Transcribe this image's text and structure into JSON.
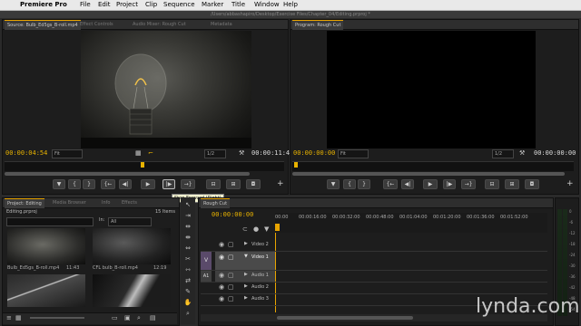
{
  "menubar": {
    "apple": "",
    "app": "Premiere Pro",
    "items": [
      "File",
      "Edit",
      "Project",
      "Clip",
      "Sequence",
      "Marker",
      "Title",
      "Window",
      "Help"
    ]
  },
  "path": "/Users/abbashapiro/Desktop/Exercise Files/Chapter_04/Editing.prproj *",
  "source": {
    "tabs": [
      "Source: Bulb_Ed5gs_B-roll.mp4",
      "Effect Controls",
      "Audio Mixer: Rough Cut",
      "Metadata"
    ],
    "timecode_in": "00:00:04:54",
    "timecode_dur": "00:00:11:43",
    "zoom": "Fit",
    "resolution": "1/2",
    "tooltip": "Step Forward (Right)"
  },
  "program": {
    "tab": "Program: Rough Cut",
    "timecode": "00:00:00:00",
    "zoom": "Fit",
    "resolution": "1/2",
    "timecode_dur": "00:00:00:00"
  },
  "project": {
    "tabs": [
      "Project: Editing",
      "Media Browser",
      "Info",
      "Effects"
    ],
    "filename": "Editing.prproj",
    "count": "15 Items",
    "in_label": "In:",
    "in_value": "All",
    "clips": [
      {
        "name": "Bulb_Ed5gs_B-roll.mp4",
        "dur": "11:43"
      },
      {
        "name": "CFL bulb_B-roll.mp4",
        "dur": "12:19"
      }
    ]
  },
  "timeline": {
    "tab": "Rough Cut",
    "timecode": "00:00:00:00",
    "ruler": [
      "00:00",
      "00:00:16:00",
      "00:00:32:00",
      "00:00:48:00",
      "00:01:04:00",
      "00:01:20:00",
      "00:01:36:00",
      "00:01:52:00"
    ],
    "tracks": [
      {
        "label": "Video 2",
        "src": ""
      },
      {
        "label": "Video 1",
        "src": "V"
      },
      {
        "label": "Audio 1",
        "src": "A1"
      },
      {
        "label": "Audio 2",
        "src": ""
      },
      {
        "label": "Audio 3",
        "src": ""
      }
    ]
  },
  "meter": [
    "0",
    "-6",
    "-12",
    "-18",
    "-24",
    "-30",
    "-36",
    "-42",
    "-48",
    "-54"
  ],
  "watermark": "lynda.com"
}
